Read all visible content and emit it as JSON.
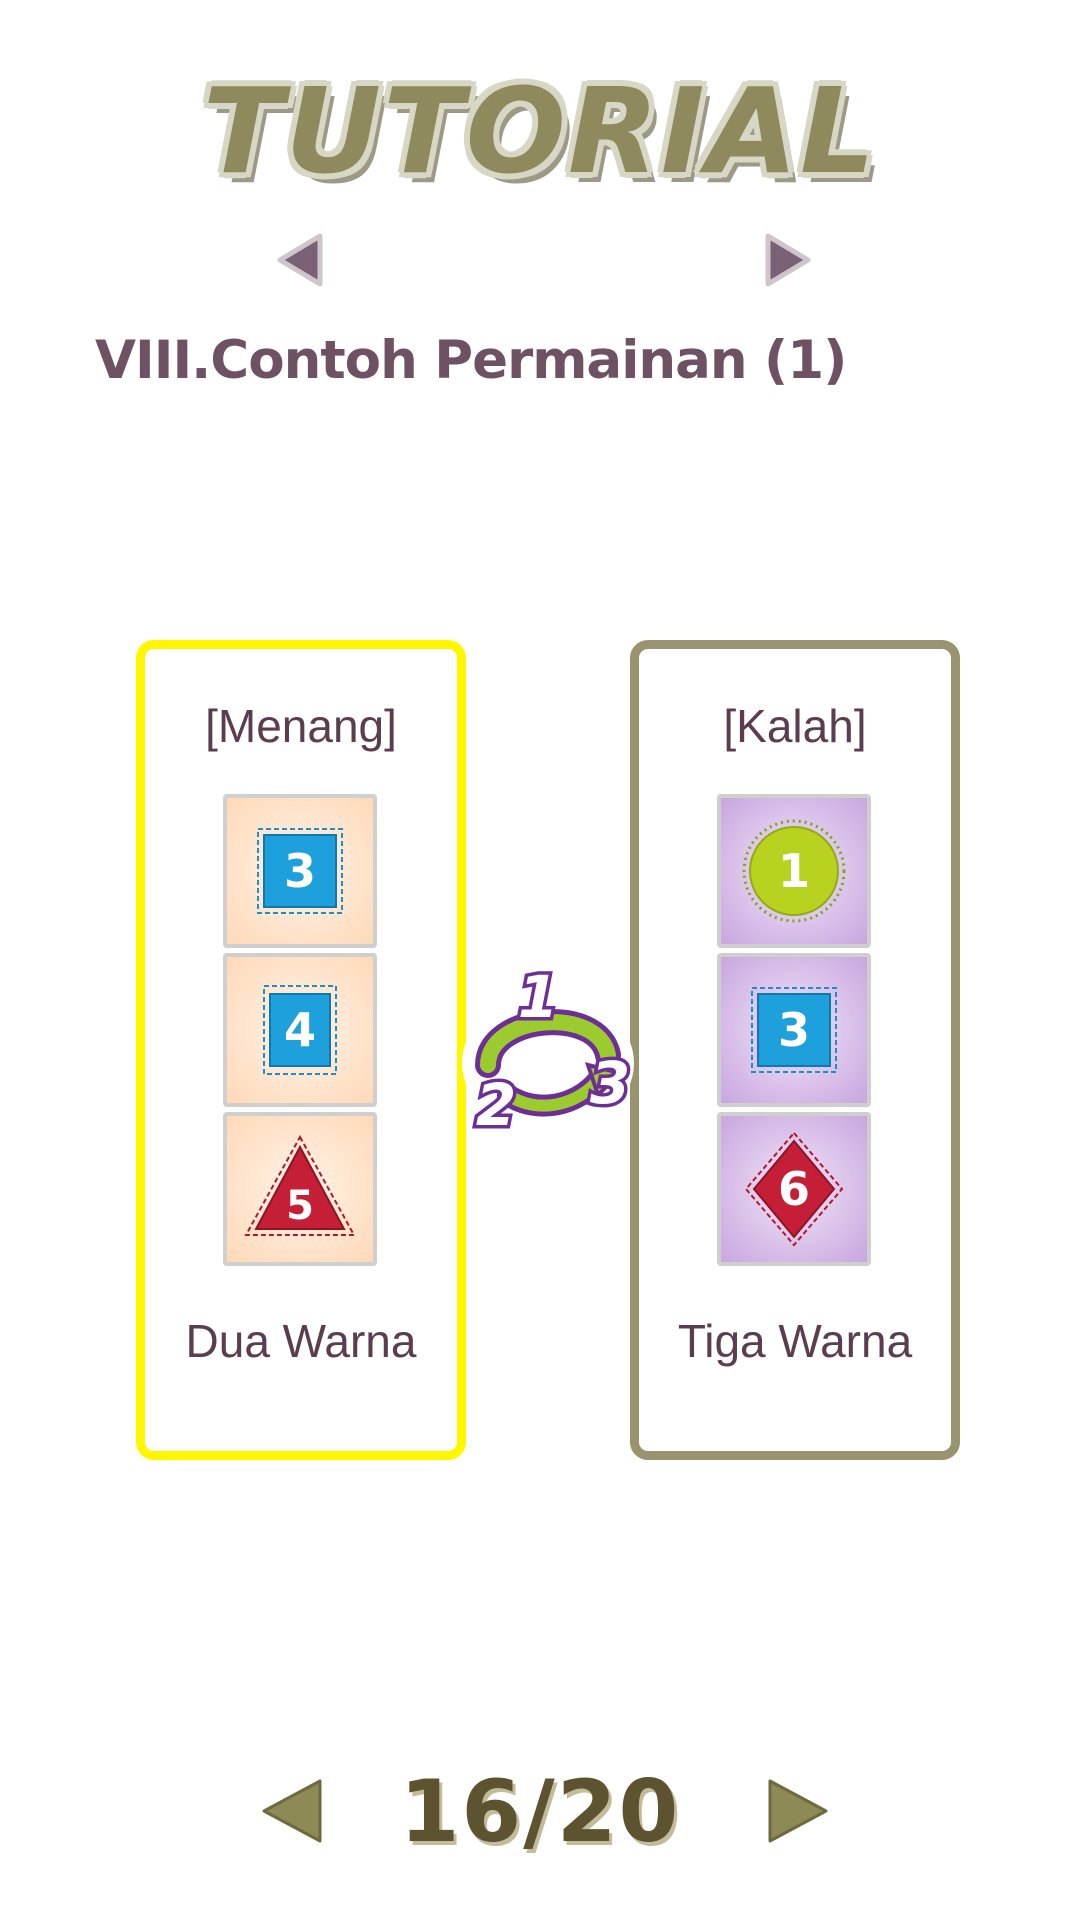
{
  "header": {
    "title": "TUTORIAL"
  },
  "section": {
    "title": "VIII.Contoh Permainan (1)"
  },
  "panels": [
    {
      "title": "[Menang]",
      "footer": "Dua Warna",
      "border_color": "#fff700",
      "tiles": [
        {
          "shape": "square",
          "color": "#1da0dc",
          "number": "3"
        },
        {
          "shape": "square",
          "color": "#1da0dc",
          "number": "4"
        },
        {
          "shape": "triangle",
          "color": "#c41f36",
          "number": "5"
        }
      ]
    },
    {
      "title": "[Kalah]",
      "footer": "Tiga Warna",
      "border_color": "#9a946e",
      "tiles": [
        {
          "shape": "circle",
          "color": "#b9d21f",
          "number": "1"
        },
        {
          "shape": "square",
          "color": "#1da0dc",
          "number": "3"
        },
        {
          "shape": "diamond",
          "color": "#c41f36",
          "number": "6"
        }
      ]
    }
  ],
  "logo": {
    "numbers": [
      "1",
      "2",
      "3"
    ]
  },
  "pagination": {
    "current": "16",
    "separator": "/",
    "total": "20"
  },
  "icons": {
    "small_prev": "triangle-left-icon",
    "small_next": "triangle-right-icon",
    "page_prev": "triangle-left-icon",
    "page_next": "triangle-right-icon"
  }
}
